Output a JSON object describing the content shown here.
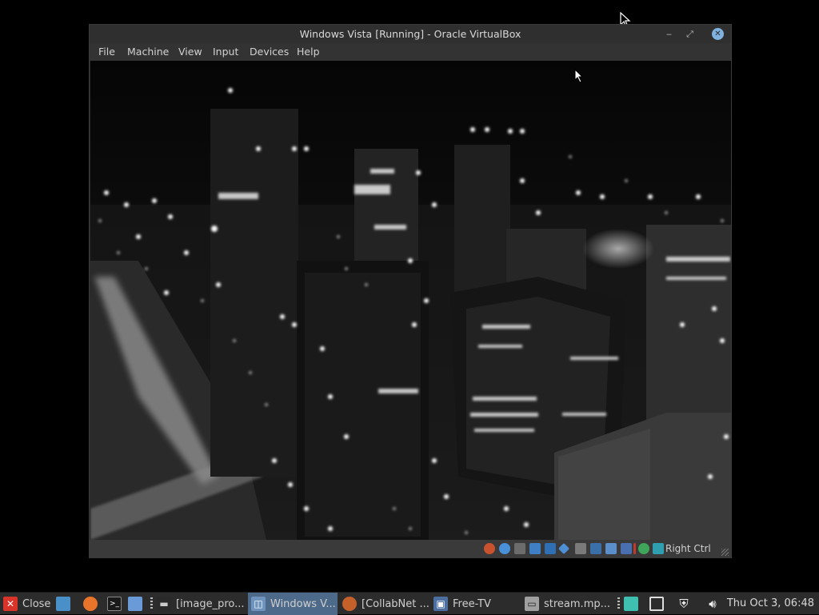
{
  "window": {
    "title": "Windows Vista [Running] - Oracle VirtualBox",
    "menu": [
      "File",
      "Machine",
      "View",
      "Input",
      "Devices",
      "Help"
    ],
    "host_key_label": "Right Ctrl"
  },
  "status_icons": [
    "hard-disk-icon",
    "optical-drive-icon",
    "floppy-icon",
    "audio-icon",
    "network-icon",
    "usb-icon",
    "shared-folders-icon",
    "display-icon",
    "recording-icon",
    "cpu-icon",
    "vt-x-icon",
    "mouse-integration-icon",
    "keyboard-capture-icon"
  ],
  "taskbar": {
    "close_label": "Close",
    "tasks": [
      {
        "label": "[image_pro...",
        "icon": "terminal-icon"
      },
      {
        "label": "Windows V...",
        "icon": "virtualbox-icon",
        "active": true
      },
      {
        "label": "[CollabNet ...",
        "icon": "firefox-icon"
      },
      {
        "label": "Free-TV",
        "icon": "tv-icon"
      },
      {
        "label": "stream.mp...",
        "icon": "video-file-icon"
      }
    ],
    "clock": "Thu Oct  3, 06:48"
  },
  "colors": {
    "active_task": "#4d6a8a",
    "close_red": "#d8342a"
  }
}
